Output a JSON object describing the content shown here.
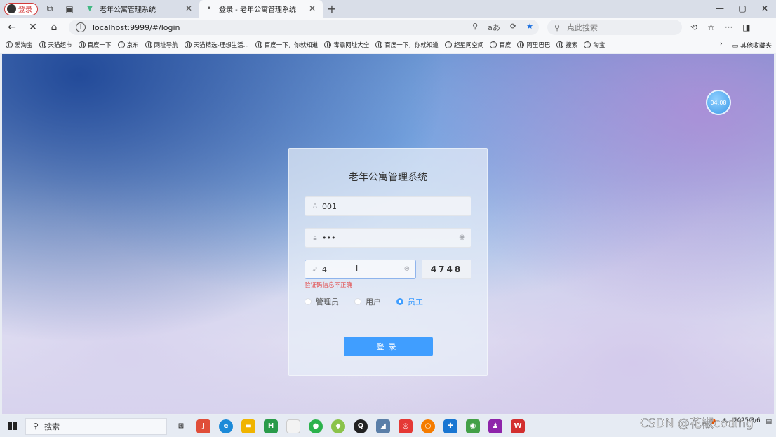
{
  "browser": {
    "profile_label": "登录",
    "tabs": [
      {
        "title": "老年公寓管理系统"
      },
      {
        "title": "登录 - 老年公寓管理系统"
      }
    ],
    "url": "localhost:9999/#/login",
    "search_placeholder": "点此搜索",
    "bookmarks": [
      "爱淘宝",
      "天猫超市",
      "百度一下",
      "京东",
      "网址导航",
      "天猫精选-理想生活...",
      "百度一下，你就知道",
      "毒霸网址大全",
      "百度一下，你就知道",
      "超星网空间",
      "百度",
      "阿里巴巴",
      "搜索",
      "淘宝"
    ],
    "other_bookmarks": "其他收藏夹"
  },
  "page": {
    "clock": "04:08",
    "login": {
      "title": "老年公寓管理系统",
      "username_value": "001",
      "password_value": "•••",
      "captcha_input_value": "4",
      "captcha_code": "4748",
      "error_message": "验证码信息不正确",
      "roles": [
        {
          "label": "管理员",
          "selected": false
        },
        {
          "label": "用户",
          "selected": false
        },
        {
          "label": "员工",
          "selected": true
        }
      ],
      "submit_label": "登录"
    }
  },
  "taskbar": {
    "search_label": "搜索",
    "date": "2025/3/6",
    "watermark": "CSDN @花椒coding"
  },
  "colors": {
    "primary": "#409eff",
    "error": "#e25252"
  }
}
